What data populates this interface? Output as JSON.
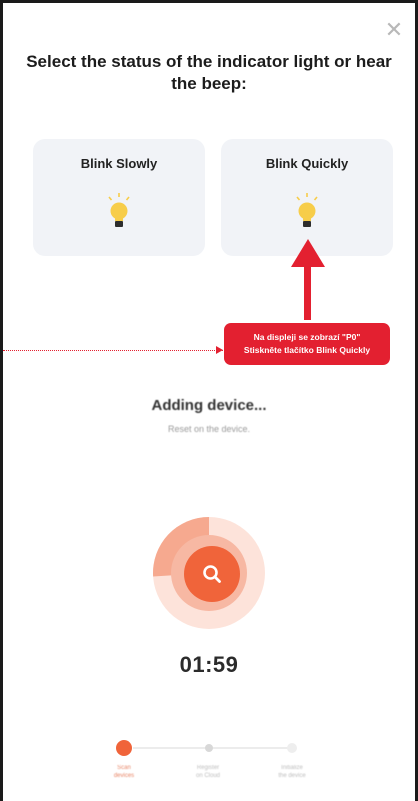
{
  "dialog": {
    "close_icon": "close-icon",
    "title": "Select the status of the indicator light or hear the beep:"
  },
  "options": [
    {
      "label": "Blink Slowly",
      "icon": "light-bulb-icon"
    },
    {
      "label": "Blink Quickly",
      "icon": "light-bulb-icon"
    }
  ],
  "callout": {
    "line1": "Na displeji se zobrazí \"P0\"",
    "line2": "Stiskněte tlačítko Blink Quickly"
  },
  "progress": {
    "title": "Adding device...",
    "subtitle": "Reset on the device.",
    "timer": "01:59",
    "fraction": 0.26,
    "search_icon": "search-icon"
  },
  "steps": [
    {
      "label_line1": "Scan",
      "label_line2": "devices"
    },
    {
      "label_line1": "Register",
      "label_line2": "on Cloud"
    },
    {
      "label_line1": "Initialize",
      "label_line2": "the device"
    }
  ],
  "colors": {
    "accent": "#f0643a",
    "annotation": "#e32030",
    "card_bg": "#f1f3f7",
    "bulb": "#f7cd4a"
  }
}
